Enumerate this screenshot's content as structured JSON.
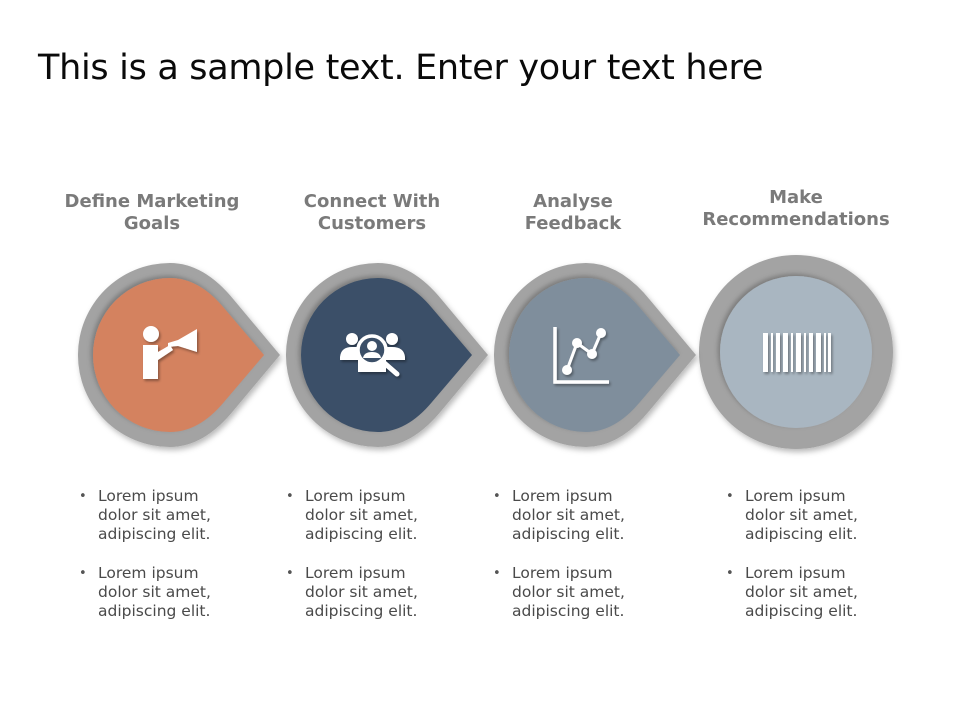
{
  "title": "This is a sample text. Enter your text here",
  "colors": {
    "ring": "#a3a3a3",
    "step1": "#d4825f",
    "step2": "#3b4f67",
    "step3": "#7f8e9c",
    "step4": "#a9b6c1",
    "title_gray": "#7a7a7a"
  },
  "steps": [
    {
      "title": "Define Marketing Goals",
      "title_lines": [
        "Define Marketing",
        "Goals"
      ],
      "icon": "megaphone-person-icon",
      "bullets": [
        "Lorem ipsum dolor sit amet, adipiscing elit.",
        "Lorem ipsum dolor sit amet, adipiscing elit."
      ],
      "bullet_lines": [
        [
          "Lorem ipsum",
          "dolor sit amet,",
          "adipiscing elit."
        ],
        [
          "Lorem ipsum",
          "dolor sit amet,",
          "adipiscing elit."
        ]
      ]
    },
    {
      "title": "Connect With Customers",
      "title_lines": [
        "Connect With",
        "Customers"
      ],
      "icon": "customer-search-icon",
      "bullet_lines": [
        [
          "Lorem ipsum",
          "dolor sit amet,",
          "adipiscing elit."
        ],
        [
          "Lorem ipsum",
          "dolor sit amet,",
          "adipiscing elit."
        ]
      ]
    },
    {
      "title": "Analyse Feedback",
      "title_lines": [
        "Analyse",
        "Feedback"
      ],
      "icon": "line-chart-icon",
      "bullet_lines": [
        [
          "Lorem ipsum",
          "dolor sit amet,",
          "adipiscing elit."
        ],
        [
          "Lorem ipsum",
          "dolor sit amet,",
          "adipiscing elit."
        ]
      ]
    },
    {
      "title": "Make Recommendations",
      "title_lines": [
        "Make",
        "Recommendations"
      ],
      "icon": "barcode-icon",
      "bullet_lines": [
        [
          "Lorem ipsum",
          "dolor sit amet,",
          "adipiscing elit."
        ],
        [
          "Lorem ipsum",
          "dolor sit amet,",
          "adipiscing elit."
        ]
      ]
    }
  ],
  "bullet_char": "•"
}
